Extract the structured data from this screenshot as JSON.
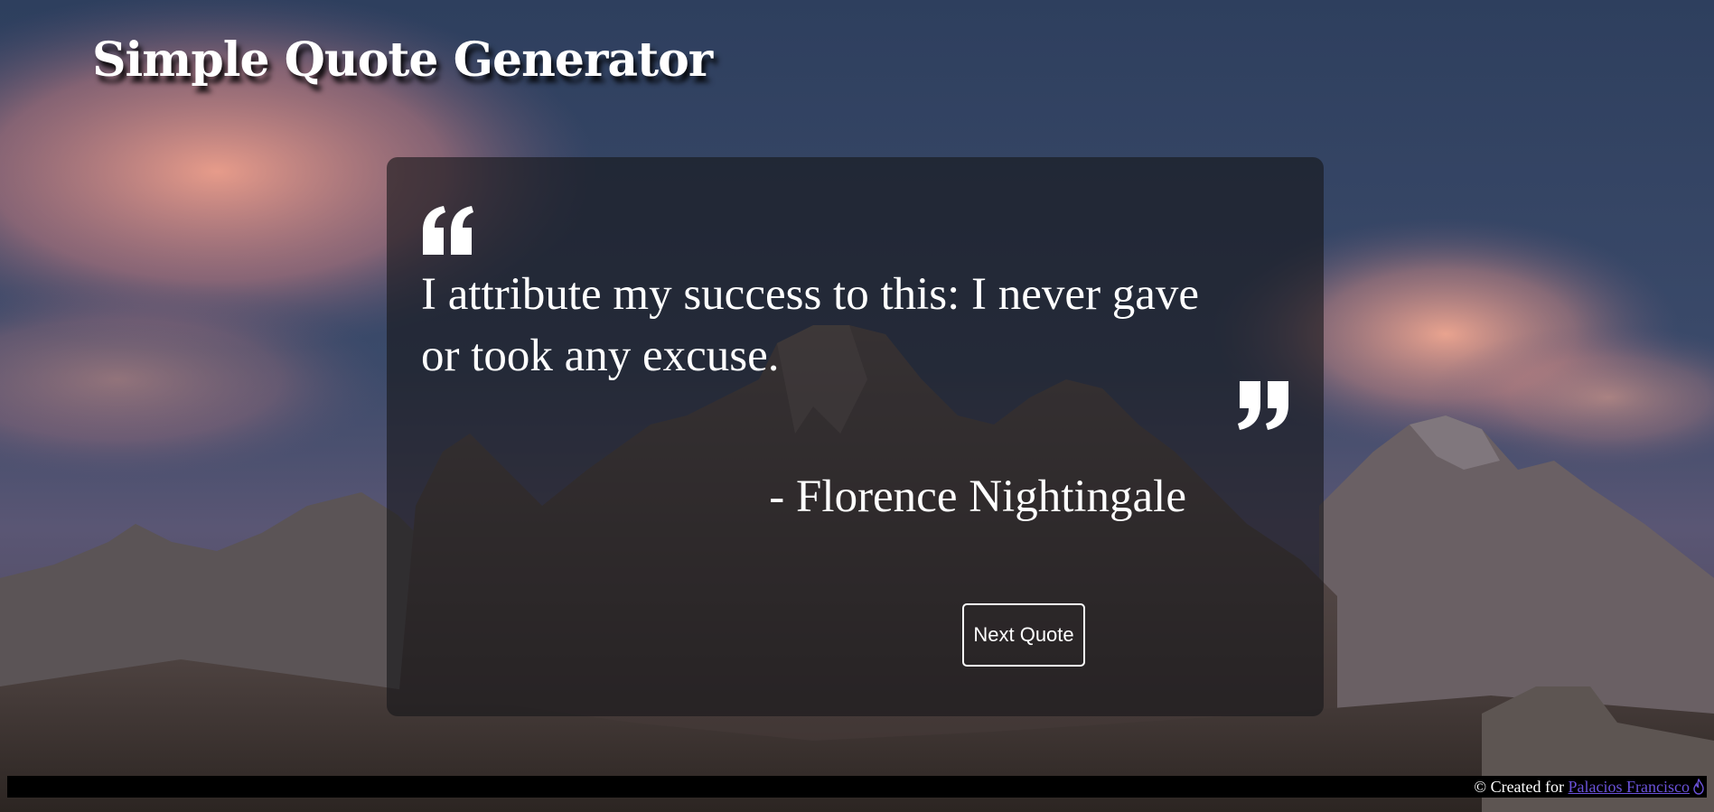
{
  "header": {
    "title": "Simple Quote Generator"
  },
  "quote": {
    "text": "I attribute my success to this: I never gave or took any excuse.",
    "author": "- Florence Nightingale",
    "open_icon": "quote-left-icon",
    "close_icon": "quote-right-icon"
  },
  "actions": {
    "next_label": "Next Quote"
  },
  "footer": {
    "prefix": "© Created for ",
    "link_text": "Palacios Francisco",
    "icon": "flame-icon"
  },
  "colors": {
    "card_background": "#16161a",
    "text": "#ffffff",
    "link": "#6a52d9",
    "footer_background": "#000000"
  }
}
